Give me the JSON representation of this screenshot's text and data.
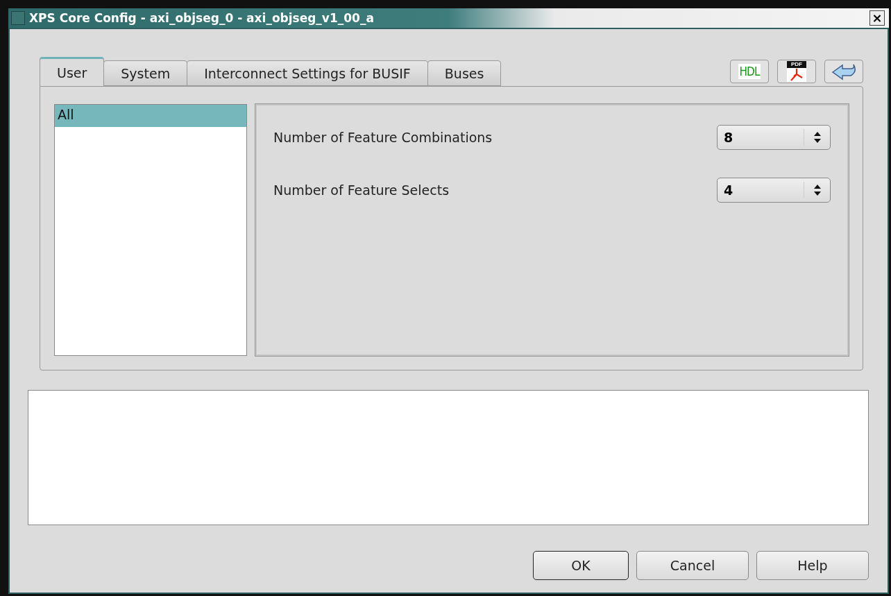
{
  "window": {
    "title": "XPS Core Config - axi_objseg_0 - axi_objseg_v1_00_a",
    "close": "×"
  },
  "tabs": [
    {
      "label": "User",
      "selected": true
    },
    {
      "label": "System",
      "selected": false
    },
    {
      "label": "Interconnect Settings for BUSIF",
      "selected": false
    },
    {
      "label": "Buses",
      "selected": false
    }
  ],
  "toolbar": [
    {
      "kind": "hdl",
      "label": "HDL"
    },
    {
      "kind": "pdf",
      "label": "PDF"
    },
    {
      "kind": "back"
    }
  ],
  "categories": [
    {
      "label": "All",
      "selected": true
    }
  ],
  "parameters": [
    {
      "label": "Number of Feature Combinations",
      "value": "8"
    },
    {
      "label": "Number of Feature Selects",
      "value": "4"
    }
  ],
  "buttons": [
    {
      "label": "OK",
      "default": true
    },
    {
      "label": "Cancel",
      "default": false
    },
    {
      "label": "Help",
      "default": false
    }
  ]
}
